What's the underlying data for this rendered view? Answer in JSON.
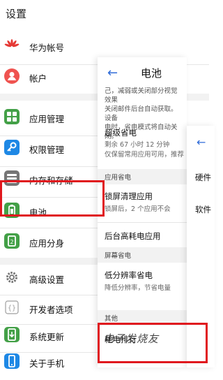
{
  "header": {
    "title": "设置"
  },
  "settings": {
    "items": [
      {
        "label": "华为帐号",
        "icon": "huawei-logo-icon",
        "color": "#e53935"
      },
      {
        "label": "帐户",
        "icon": "account-icon",
        "color": "#ef5350"
      },
      {
        "label": "应用管理",
        "icon": "apps-grid-icon",
        "color": "#43a047"
      },
      {
        "label": "权限管理",
        "icon": "key-icon",
        "color": "#1e88e5"
      },
      {
        "label": "内存和存储",
        "icon": "storage-icon",
        "color": "#757575"
      },
      {
        "label": "电池",
        "icon": "battery-icon",
        "color": "#43a047"
      },
      {
        "label": "应用分身",
        "icon": "app-twin-icon",
        "color": "#43a047"
      },
      {
        "label": "高级设置",
        "icon": "gear-icon",
        "color": "#757575"
      },
      {
        "label": "开发者选项",
        "icon": "braces-icon",
        "color": "#9e9e9e"
      },
      {
        "label": "系统更新",
        "icon": "update-icon",
        "color": "#43a047"
      },
      {
        "label": "关于手机",
        "icon": "phone-icon",
        "color": "#1e88e5"
      }
    ]
  },
  "battery_panel": {
    "title": "电池",
    "description": "己，减弱或关闭部分视觉效果\n关闭邮件后台自动获取。设备\n电时，省电模式将自动关闭。",
    "super_saver": {
      "title": "超级省电",
      "subtitle": "剩余 67 小时 12 分钟",
      "subtitle2": "仅保留常用应用可用，推荐"
    },
    "section_app": "应用省电",
    "lock_clean": {
      "title": "锁屏清理应用",
      "subtitle": "锁屏后，2 个应用不会"
    },
    "background_drain": {
      "title": "后台高耗电应用"
    },
    "section_screen": "屏幕省电",
    "low_res": {
      "title": "低分辨率省电",
      "subtitle": "降低分辨率，节省电量"
    },
    "section_other": "其他",
    "ranking": {
      "title": "耗电排行"
    }
  },
  "third_panel": {
    "items": [
      "硬件",
      "软件"
    ]
  },
  "watermark": "电子发烧友",
  "accent_color": "#2f6bd8",
  "highlight_color": "#e0181e"
}
